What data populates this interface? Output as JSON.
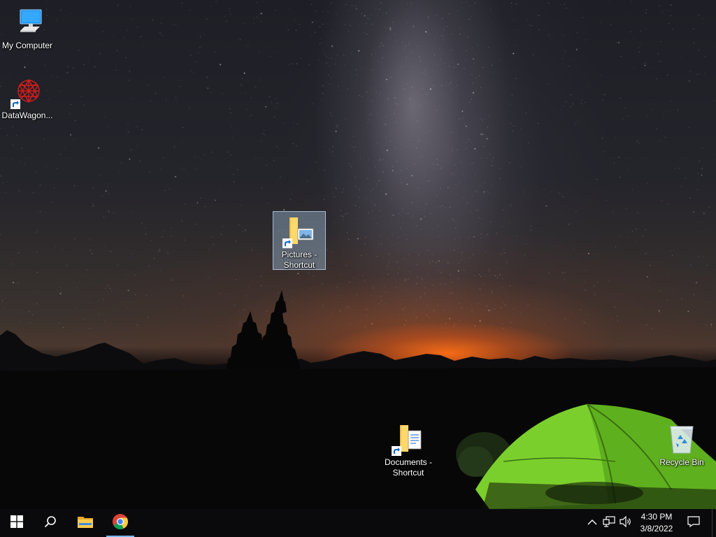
{
  "desktop": {
    "icons": [
      {
        "label": "My Computer",
        "icon": "computer-icon"
      },
      {
        "label": "DataWagon...",
        "icon": "datawagon-icon"
      },
      {
        "label": "Pictures - Shortcut",
        "icon": "pictures-folder-icon"
      },
      {
        "label": "Documents - Shortcut",
        "icon": "documents-folder-icon"
      },
      {
        "label": "Recycle Bin",
        "icon": "recycle-bin-icon"
      }
    ],
    "selected_icon": "Pictures - Shortcut"
  },
  "taskbar": {
    "start": {
      "icon": "windows-start-icon"
    },
    "search": {
      "icon": "search-icon"
    },
    "pinned": [
      {
        "icon": "file-explorer-icon"
      },
      {
        "icon": "chrome-icon",
        "active": true
      }
    ],
    "tray": {
      "icons": [
        "chevron-up-icon",
        "network-icon",
        "volume-icon"
      ],
      "time": "4:30 PM",
      "date": "3/8/2022"
    },
    "notification": {
      "icon": "notification-icon"
    }
  },
  "colors": {
    "taskbar_bg": "#0a0a0c",
    "active_indicator": "#76b9ed",
    "selection": "#a0bedc"
  }
}
